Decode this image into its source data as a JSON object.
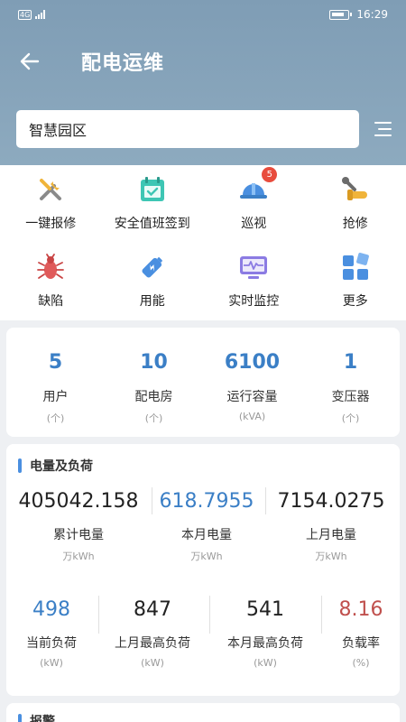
{
  "status_bar": {
    "network": "4G",
    "time": "16:29"
  },
  "header": {
    "title": "配电运维"
  },
  "search": {
    "value": "智慧园区"
  },
  "quick_actions": [
    {
      "label": "一键报修",
      "icon": "tools-icon"
    },
    {
      "label": "安全值班签到",
      "icon": "calendar-check-icon"
    },
    {
      "label": "巡视",
      "icon": "helmet-icon",
      "badge": "5"
    },
    {
      "label": "抢修",
      "icon": "repair-hand-icon"
    },
    {
      "label": "缺陷",
      "icon": "bug-icon"
    },
    {
      "label": "用能",
      "icon": "battery-icon"
    },
    {
      "label": "实时监控",
      "icon": "monitor-icon"
    },
    {
      "label": "更多",
      "icon": "grid-icon"
    }
  ],
  "stats": [
    {
      "value": "5",
      "label": "用户",
      "unit": "(个)"
    },
    {
      "value": "10",
      "label": "配电房",
      "unit": "(个)"
    },
    {
      "value": "6100",
      "label": "运行容量",
      "unit": "(kVA)"
    },
    {
      "value": "1",
      "label": "变压器",
      "unit": "(个)"
    }
  ],
  "energy": {
    "title": "电量及负荷",
    "row1": [
      {
        "value": "405042.158",
        "label": "累计电量",
        "unit": "万kWh"
      },
      {
        "value": "618.7955",
        "label": "本月电量",
        "unit": "万kWh"
      },
      {
        "value": "7154.0275",
        "label": "上月电量",
        "unit": "万kWh"
      }
    ],
    "row2": [
      {
        "value": "498",
        "label": "当前负荷",
        "unit": "(kW)"
      },
      {
        "value": "847",
        "label": "上月最高负荷",
        "unit": "(kW)"
      },
      {
        "value": "541",
        "label": "本月最高负荷",
        "unit": "(kW)"
      },
      {
        "value": "8.16",
        "label": "负载率",
        "unit": "(%)"
      }
    ]
  },
  "alarm": {
    "title": "报警"
  },
  "colors": {
    "header": "#8aa6bb",
    "accent": "#3b7fc6",
    "alert": "#c0504d"
  }
}
